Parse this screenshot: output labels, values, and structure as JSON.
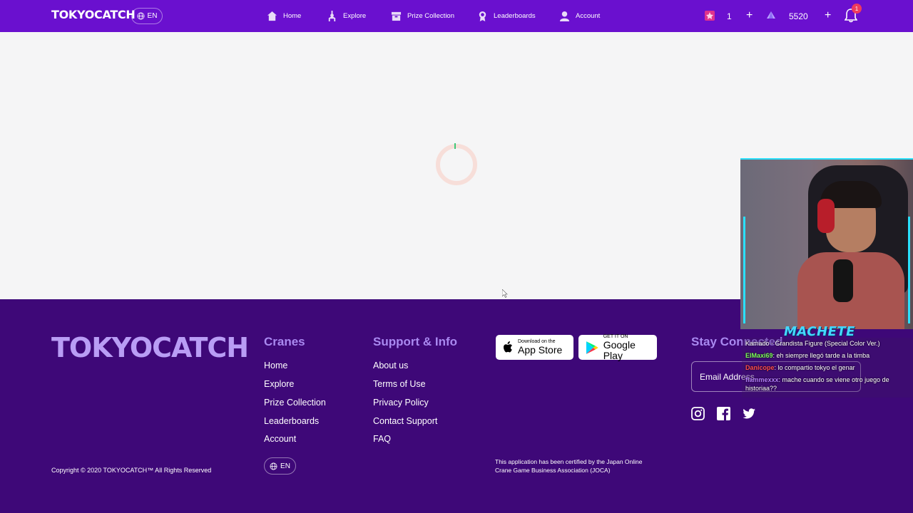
{
  "header": {
    "logo_text": "TOKYOCATCH",
    "language": "EN",
    "nav": [
      {
        "label": "Home",
        "icon": "home-icon"
      },
      {
        "label": "Explore",
        "icon": "crane-icon"
      },
      {
        "label": "Prize Collection",
        "icon": "prize-box-icon"
      },
      {
        "label": "Leaderboards",
        "icon": "trophy-icon"
      },
      {
        "label": "Account",
        "icon": "user-icon"
      }
    ],
    "tickets_count": "1",
    "points_count": "5520",
    "notification_count": "1"
  },
  "main": {
    "state": "loading"
  },
  "footer": {
    "logo_text": "TOKYOCATCH",
    "cranes": {
      "title": "Cranes",
      "links": [
        "Home",
        "Explore",
        "Prize Collection",
        "Leaderboards",
        "Account"
      ]
    },
    "support": {
      "title": "Support & Info",
      "links": [
        "About us",
        "Terms of Use",
        "Privacy Policy",
        "Contact Support",
        "FAQ"
      ]
    },
    "app_store": {
      "small": "Download on the",
      "big": "App Store"
    },
    "google_play": {
      "small": "GET IT ON",
      "big": "Google Play"
    },
    "stay_connected": {
      "title": "Stay Connected",
      "email_placeholder": "Email Address"
    },
    "social": [
      "instagram-icon",
      "facebook-icon",
      "twitter-icon"
    ],
    "copyright": "Copyright © 2020 TOKYOCATCH™ All Rights Reserved",
    "language": "EN",
    "certification": "This application has been certified by the Japan Online Crane Game Business Association (JOCA)"
  },
  "stream_overlay": {
    "streamer_name": "MACHETE",
    "chat": [
      {
        "user": "",
        "message": "Kamado - Grandista Figure (Special Color Ver.)",
        "color": "#ffffff"
      },
      {
        "user": "ElMaxi69",
        "message": ": eh siempre llegó tarde a la timba",
        "color": "#7dff5a"
      },
      {
        "user": "Danicope",
        "message": ": lo compartio tokyo el genar",
        "color": "#ff4d4d"
      },
      {
        "user": "flammexxx",
        "message": ": mache cuando se viene otro juego de historiaa??",
        "color": "#b57dff"
      }
    ]
  },
  "colors": {
    "header_bg": "#6a10cf",
    "footer_bg": "#3e0878",
    "accent_text": "#a989f0",
    "badge": "#ef3a5d"
  }
}
